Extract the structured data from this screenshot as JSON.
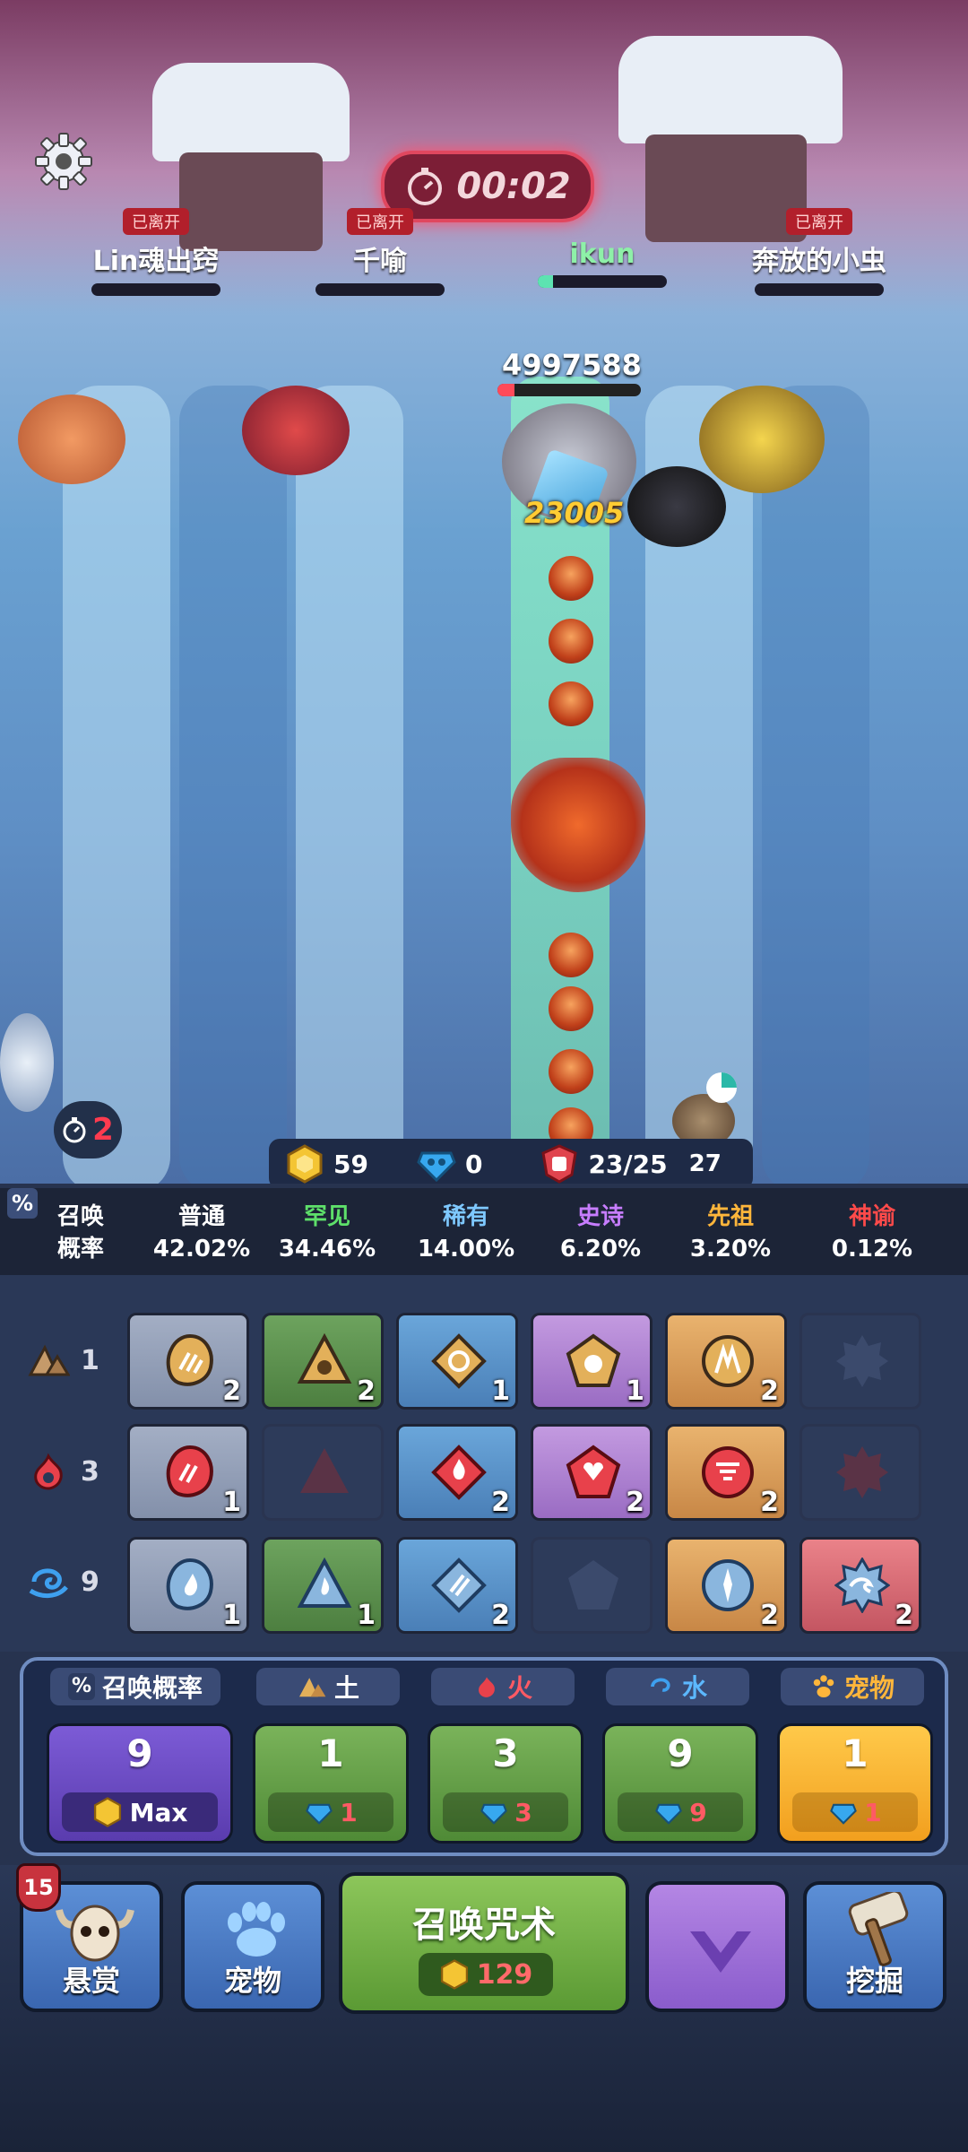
{
  "hud": {
    "timer": "00:02",
    "players": [
      {
        "status": "已离开",
        "name": "Lin魂出窍",
        "hp": 0
      },
      {
        "status": "已离开",
        "name": "千喻",
        "hp": 0
      },
      {
        "status": "",
        "name": "ikun",
        "hp": 0.12
      },
      {
        "status": "已离开",
        "name": "奔放的小虫",
        "hp": 0
      }
    ]
  },
  "battle": {
    "boss_hp": "4997588",
    "boss_hp_fraction": 0.12,
    "damage_popup": "23005",
    "wave_count": "2"
  },
  "resources": {
    "gold": "59",
    "gems": "0",
    "units": "23/25",
    "unit_cap": "27"
  },
  "summon_rates": {
    "label_line1": "召唤",
    "label_line2": "概率",
    "tiers": [
      {
        "name": "普通",
        "value": "42.02%",
        "color": "#ffffff"
      },
      {
        "name": "罕见",
        "value": "34.46%",
        "color": "#5ee06a"
      },
      {
        "name": "稀有",
        "value": "14.00%",
        "color": "#7ec8ff"
      },
      {
        "name": "史诗",
        "value": "6.20%",
        "color": "#c77dff"
      },
      {
        "name": "先祖",
        "value": "3.20%",
        "color": "#ffb63b"
      },
      {
        "name": "神谕",
        "value": "0.12%",
        "color": "#ff4a4a"
      }
    ]
  },
  "grid": {
    "rows": [
      {
        "element": "earth",
        "level": "1",
        "counts": [
          "2",
          "2",
          "1",
          "1",
          "2",
          ""
        ]
      },
      {
        "element": "fire",
        "level": "3",
        "counts": [
          "1",
          "",
          "2",
          "2",
          "2",
          ""
        ]
      },
      {
        "element": "water",
        "level": "9",
        "counts": [
          "1",
          "1",
          "2",
          "",
          "2",
          "2"
        ]
      }
    ]
  },
  "upgrades": {
    "headers": [
      "召唤概率",
      "土",
      "火",
      "水",
      "宠物"
    ],
    "cards": [
      {
        "level": "9",
        "cost": "Max"
      },
      {
        "level": "1",
        "cost": "1"
      },
      {
        "level": "3",
        "cost": "3"
      },
      {
        "level": "9",
        "cost": "9"
      },
      {
        "level": "1",
        "cost": "1"
      }
    ]
  },
  "bottom_bar": {
    "bounty_label": "悬赏",
    "bounty_badge": "15",
    "pet_label": "宠物",
    "summon_label": "召唤咒术",
    "summon_cost": "129",
    "dig_label": "挖掘"
  }
}
